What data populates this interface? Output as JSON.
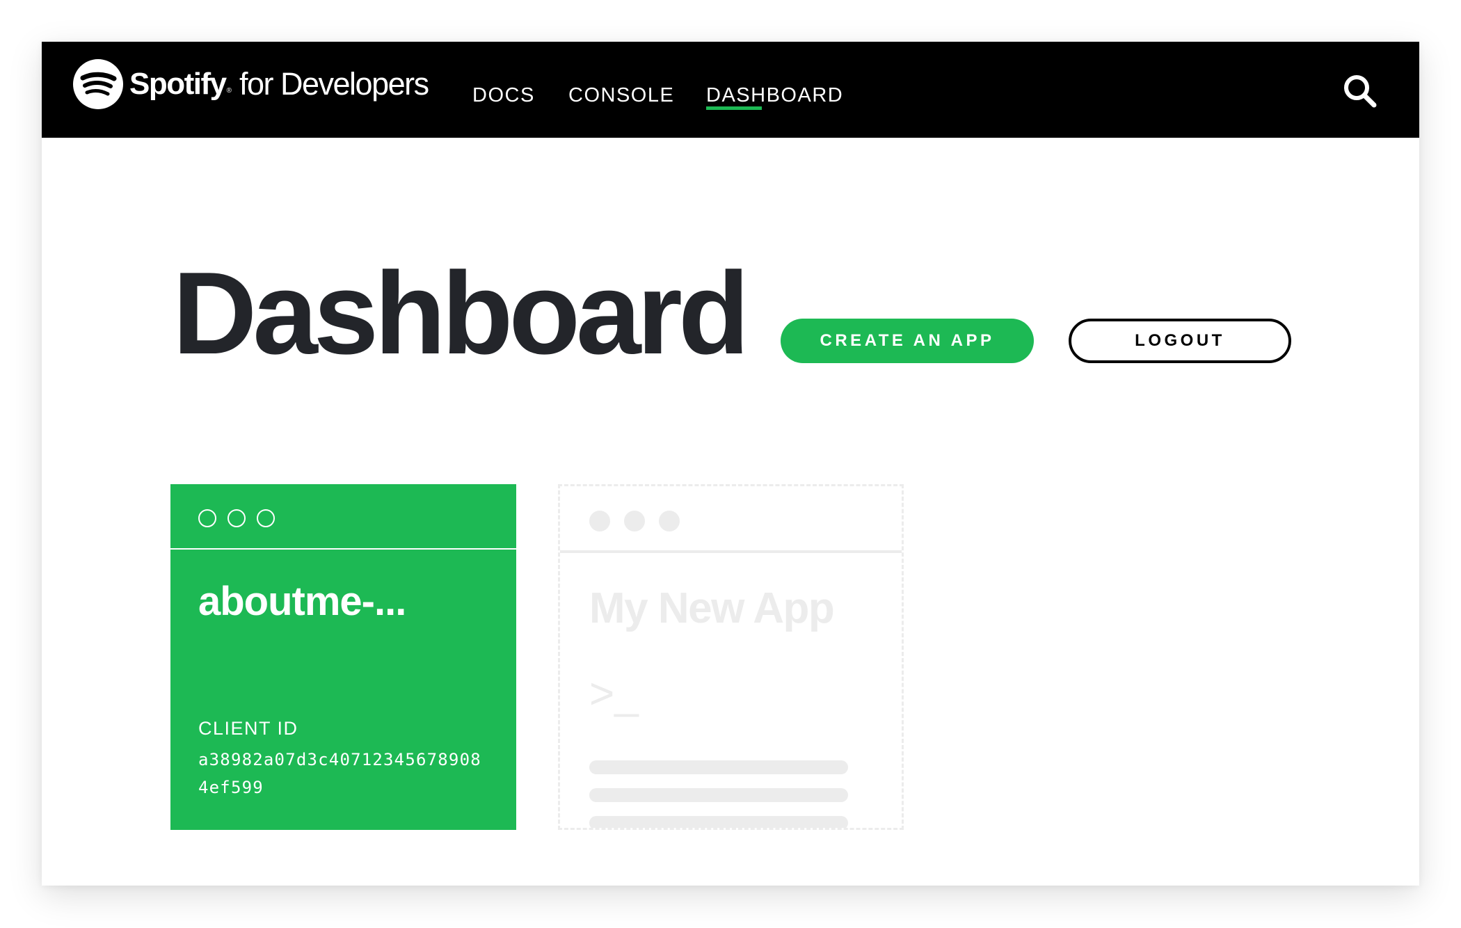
{
  "brand": {
    "name": "Spotify",
    "registered_mark": "®",
    "suffix": "for Developers",
    "logo_icon": "spotify-logo-icon"
  },
  "nav": {
    "links": [
      {
        "label": "DOCS",
        "active": false
      },
      {
        "label": "CONSOLE",
        "active": false
      },
      {
        "label": "DASHBOARD",
        "active": true
      }
    ],
    "search_icon": "search-icon"
  },
  "page": {
    "title": "Dashboard"
  },
  "actions": {
    "create_label": "CREATE AN APP",
    "logout_label": "LOGOUT"
  },
  "apps": [
    {
      "name": "aboutme-...",
      "client_id_label": "CLIENT ID",
      "client_id": "a38982a07d3c407123456789084ef599"
    }
  ],
  "new_app_placeholder": {
    "title": "My New App",
    "prompt": ">_"
  },
  "colors": {
    "accent": "#1db954",
    "navbar": "#000000",
    "title_text": "#23252a",
    "placeholder": "#ececec"
  }
}
